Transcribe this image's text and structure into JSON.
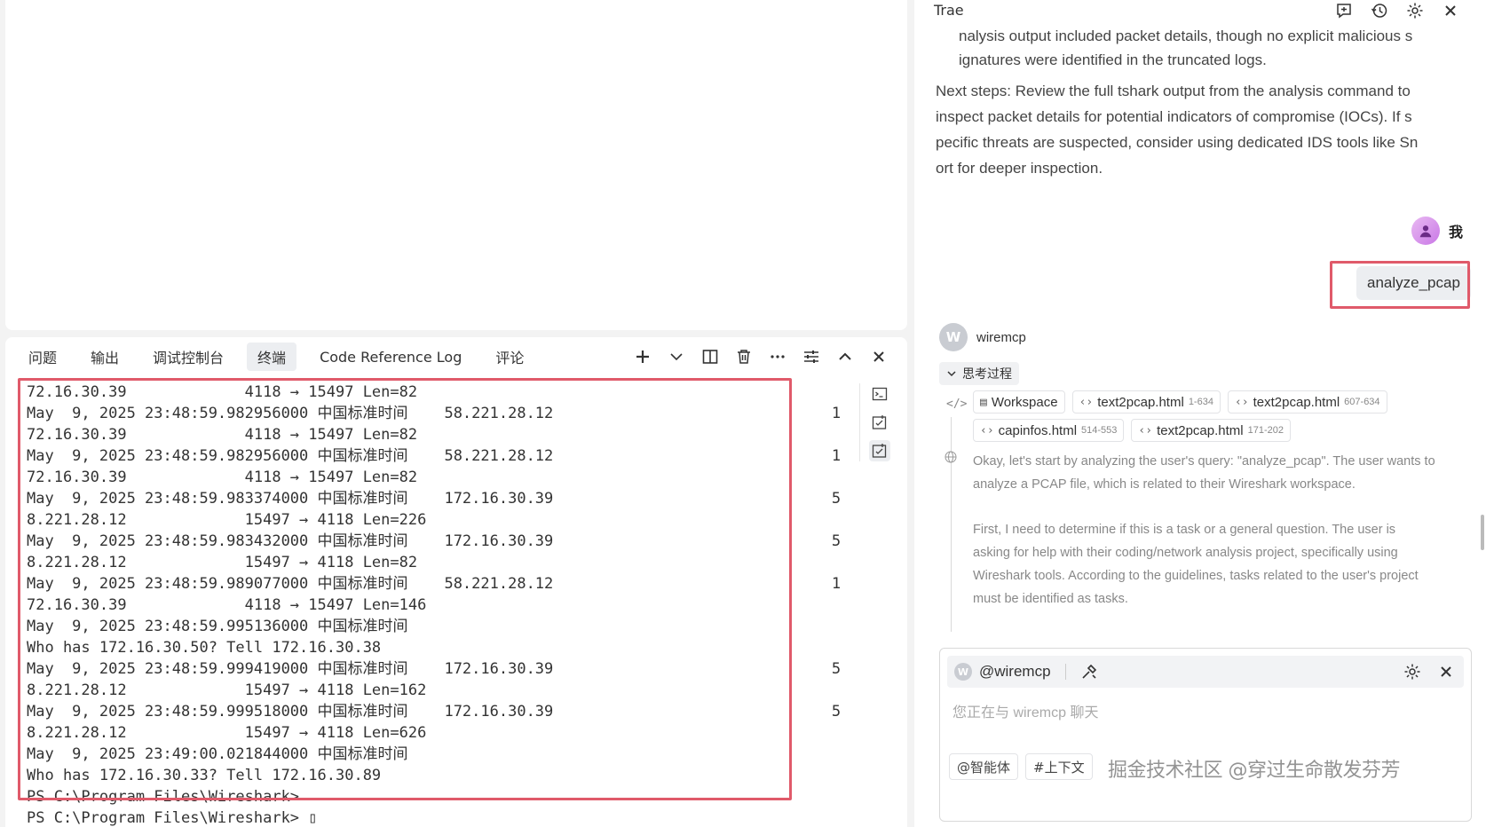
{
  "panel": {
    "tabs": [
      "问题",
      "输出",
      "调试控制台",
      "终端",
      "Code Reference Log",
      "评论"
    ],
    "active_tab_index": 3
  },
  "terminal": {
    "lines": [
      "72.16.30.39             4118 → 15497 Len=82",
      "May  9, 2025 23:48:59.982956000 中国标准时间    58.221.28.12",
      "72.16.30.39             4118 → 15497 Len=82",
      "May  9, 2025 23:48:59.982956000 中国标准时间    58.221.28.12",
      "72.16.30.39             4118 → 15497 Len=82",
      "May  9, 2025 23:48:59.983374000 中国标准时间    172.16.30.39",
      "8.221.28.12             15497 → 4118 Len=226",
      "May  9, 2025 23:48:59.983432000 中国标准时间    172.16.30.39",
      "8.221.28.12             15497 → 4118 Len=82",
      "May  9, 2025 23:48:59.989077000 中国标准时间    58.221.28.12",
      "72.16.30.39             4118 → 15497 Len=146",
      "May  9, 2025 23:48:59.995136000 中国标准时间",
      "Who has 172.16.30.50? Tell 172.16.30.38",
      "May  9, 2025 23:48:59.999419000 中国标准时间    172.16.30.39",
      "8.221.28.12             15497 → 4118 Len=162",
      "May  9, 2025 23:48:59.999518000 中国标准时间    172.16.30.39",
      "8.221.28.12             15497 → 4118 Len=626",
      "May  9, 2025 23:49:00.021844000 中国标准时间",
      "Who has 172.16.30.33? Tell 172.16.30.89",
      "PS C:\\Program Files\\Wireshark>",
      "PS C:\\Program Files\\Wireshark> ▯"
    ],
    "counts": [
      "",
      "1",
      "",
      "1",
      "",
      "5",
      "",
      "5",
      "",
      "1",
      "",
      "",
      "",
      "5",
      "",
      "5",
      "",
      "",
      "",
      "",
      ""
    ]
  },
  "chat": {
    "title": "Trae",
    "para_prev_1": "nalysis output included packet details, though no explicit malicious s",
    "para_prev_2": "ignatures were identified in the truncated logs.",
    "next_steps": [
      "Next steps: Review the full tshark output from the analysis command to",
      "inspect packet details for potential indicators of compromise (IOCs). If s",
      "pecific threats are suspected, consider using dedicated IDS tools like Sn",
      "ort for deeper inspection."
    ],
    "user_name": "我",
    "user_message": "analyze_pcap",
    "bot_initial": "W",
    "bot_name": "wiremcp",
    "think_label": "思考过程",
    "refs": [
      {
        "name": "Workspace",
        "range": "",
        "kind": "workspace"
      },
      {
        "name": "text2pcap.html",
        "range": "1-634",
        "kind": "code"
      },
      {
        "name": "text2pcap.html",
        "range": "607-634",
        "kind": "code"
      },
      {
        "name": "capinfos.html",
        "range": "514-553",
        "kind": "code"
      },
      {
        "name": "text2pcap.html",
        "range": "171-202",
        "kind": "code"
      }
    ],
    "thought_1": [
      "Okay, let's start by analyzing the user's query: \"analyze_pcap\". The user wants to",
      "analyze a PCAP file, which is related to their Wireshark workspace."
    ],
    "thought_2": [
      "First, I need to determine if this is a task or a general question. The user is",
      "asking for help with their coding/network analysis project, specifically using",
      "Wireshark tools. According to the guidelines, tasks related to the user's project",
      "must be identified as tasks."
    ],
    "input": {
      "mention": "@wiremcp",
      "placeholder": "您正在与 wiremcp 聊天",
      "btn_agent": "@智能体",
      "btn_context": "#上下文"
    },
    "watermark": "掘金技术社区 @穿过生命散发芬芳"
  }
}
